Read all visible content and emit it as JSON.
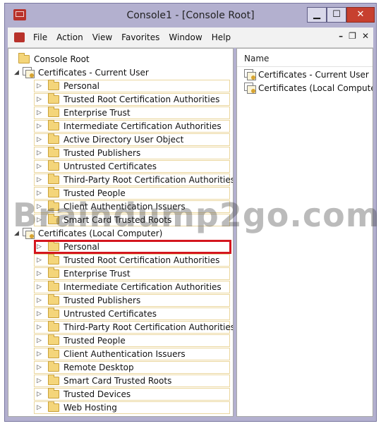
{
  "window": {
    "title": "Console1 - [Console Root]",
    "min_glyph": "▁",
    "max_glyph": "☐",
    "close_glyph": "✕",
    "mdi": {
      "min": "–",
      "restore": "❐",
      "close": "✕"
    }
  },
  "menu": [
    "File",
    "Action",
    "View",
    "Favorites",
    "Window",
    "Help"
  ],
  "tree": {
    "root": "Console Root",
    "current_user": {
      "label": "Certificates - Current User",
      "children": [
        "Personal",
        "Trusted Root Certification Authorities",
        "Enterprise Trust",
        "Intermediate Certification Authorities",
        "Active Directory User Object",
        "Trusted Publishers",
        "Untrusted Certificates",
        "Third-Party Root Certification Authorities",
        "Trusted People",
        "Client Authentication Issuers",
        "Smart Card Trusted Roots"
      ]
    },
    "local_computer": {
      "label": "Certificates (Local Computer)",
      "children": [
        "Personal",
        "Trusted Root Certification Authorities",
        "Enterprise Trust",
        "Intermediate Certification Authorities",
        "Trusted Publishers",
        "Untrusted Certificates",
        "Third-Party Root Certification Authorities",
        "Trusted People",
        "Client Authentication Issuers",
        "Remote Desktop",
        "Smart Card Trusted Roots",
        "Trusted Devices",
        "Web Hosting"
      ],
      "highlighted_index": 0
    }
  },
  "results": {
    "column": "Name",
    "items": [
      "Certificates - Current User",
      "Certificates (Local Computer)"
    ]
  },
  "watermark": "Braindump2go.com",
  "colors": {
    "highlight": "#d4161e",
    "frame": "#b3b0cf",
    "close": "#c7402f"
  }
}
